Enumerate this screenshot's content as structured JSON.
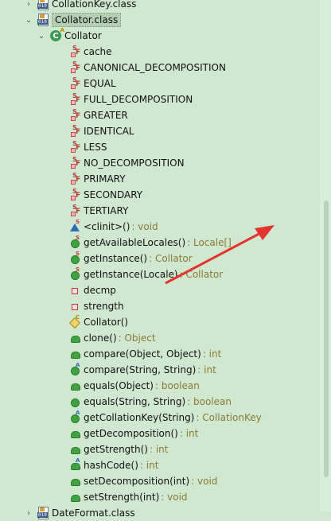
{
  "tree": {
    "collationkey_class": "CollationKey.class",
    "collator_class": "Collator.class",
    "collator_type": "Collator",
    "fields": [
      "cache",
      "CANONICAL_DECOMPOSITION",
      "EQUAL",
      "FULL_DECOMPOSITION",
      "GREATER",
      "IDENTICAL",
      "LESS",
      "NO_DECOMPOSITION",
      "PRIMARY",
      "SECONDARY",
      "TERTIARY"
    ],
    "methods": [
      {
        "name": "<clinit>()",
        "type": ": void"
      },
      {
        "name": "getAvailableLocales()",
        "type": ": Locale[]"
      },
      {
        "name": "getInstance()",
        "type": ": Collator"
      },
      {
        "name": "getInstance(Locale)",
        "type": ": Collator"
      },
      {
        "name": "decmp",
        "type": ""
      },
      {
        "name": "strength",
        "type": ""
      },
      {
        "name": "Collator()",
        "type": ""
      },
      {
        "name": "clone()",
        "type": ": Object"
      },
      {
        "name": "compare(Object, Object)",
        "type": ": int"
      },
      {
        "name": "compare(String, String)",
        "type": ": int"
      },
      {
        "name": "equals(Object)",
        "type": ": boolean"
      },
      {
        "name": "equals(String, String)",
        "type": ": boolean"
      },
      {
        "name": "getCollationKey(String)",
        "type": ": CollationKey"
      },
      {
        "name": "getDecomposition()",
        "type": ": int"
      },
      {
        "name": "getStrength()",
        "type": ": int"
      },
      {
        "name": "hashCode()",
        "type": ": int"
      },
      {
        "name": "setDecomposition(int)",
        "type": ": void"
      },
      {
        "name": "setStrength(int)",
        "type": ": void"
      }
    ],
    "next_class": "DateFormat.class"
  },
  "colors": {
    "background": "#cfe8cf",
    "annotation_arrow": "#e3342f",
    "type_text": "#8a7a3a"
  }
}
